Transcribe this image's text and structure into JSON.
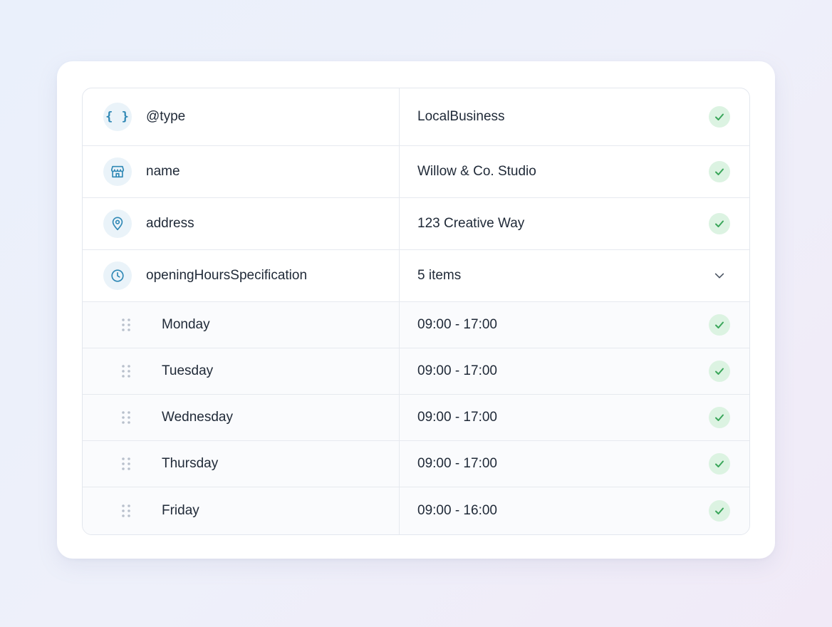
{
  "rows": [
    {
      "key": "@type",
      "value": "LocalBusiness",
      "icon": "braces-icon"
    },
    {
      "key": "name",
      "value": "Willow & Co. Studio",
      "icon": "storefront-icon"
    },
    {
      "key": "address",
      "value": "123 Creative Way",
      "icon": "map-pin-icon"
    },
    {
      "key": "openingHoursSpecification",
      "value": "5 items",
      "icon": "clock-icon"
    }
  ],
  "hours": [
    {
      "day": "Monday",
      "time": "09:00 - 17:00"
    },
    {
      "day": "Tuesday",
      "time": "09:00 - 17:00"
    },
    {
      "day": "Wednesday",
      "time": "09:00 - 17:00"
    },
    {
      "day": "Thursday",
      "time": "09:00 - 17:00"
    },
    {
      "day": "Friday",
      "time": "09:00 - 16:00"
    }
  ],
  "type_icon_glyph": "{ }",
  "colors": {
    "accent": "#2f88b5",
    "success": "#3aa65a",
    "success_bg": "#dcf3e2",
    "border": "#e6e9ef"
  }
}
